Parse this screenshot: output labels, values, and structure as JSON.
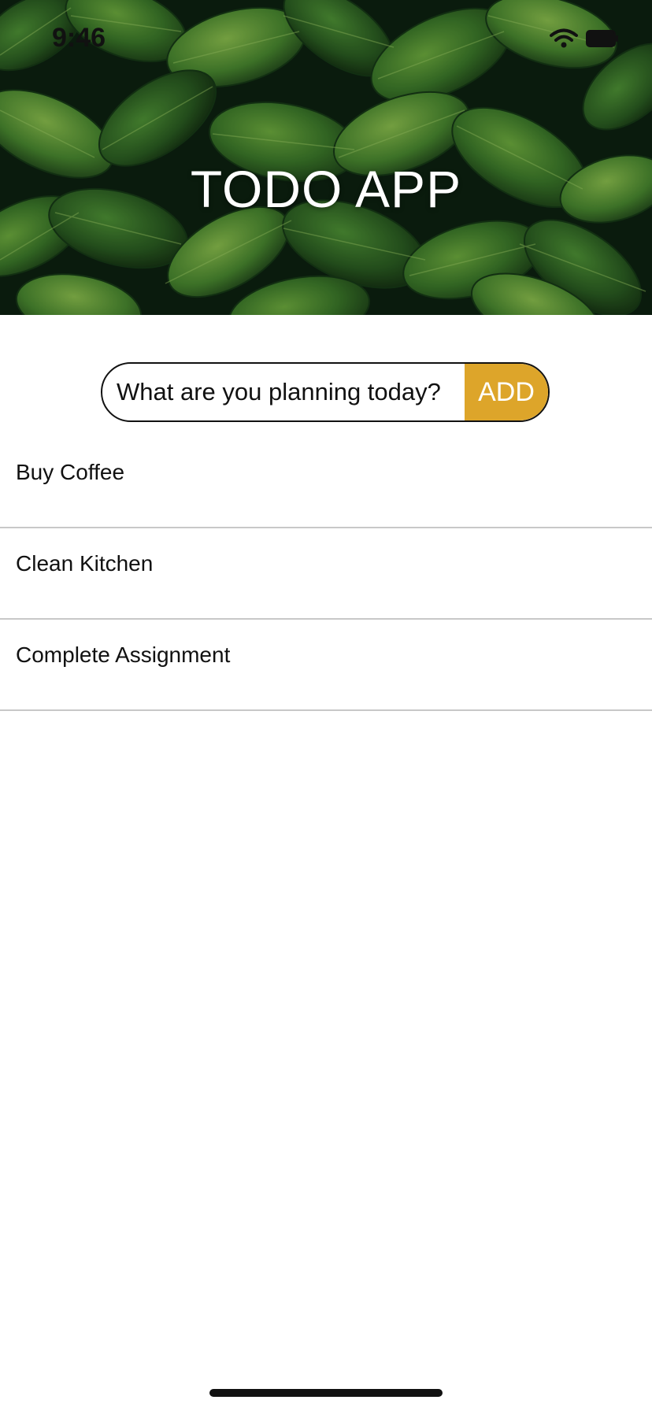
{
  "status_bar": {
    "time": "9:46",
    "icons": [
      "wifi-icon",
      "battery-icon"
    ]
  },
  "header": {
    "title": "TODO APP",
    "background": "green-leaves-photo"
  },
  "composer": {
    "placeholder": "What are you planning today?",
    "value": "",
    "add_label": "ADD"
  },
  "todos": [
    {
      "label": "Buy Coffee"
    },
    {
      "label": "Clean Kitchen"
    },
    {
      "label": "Complete Assignment"
    }
  ],
  "colors": {
    "accent": "#dda52a",
    "divider": "#c8c8c8",
    "text": "#111111",
    "background": "#ffffff"
  }
}
